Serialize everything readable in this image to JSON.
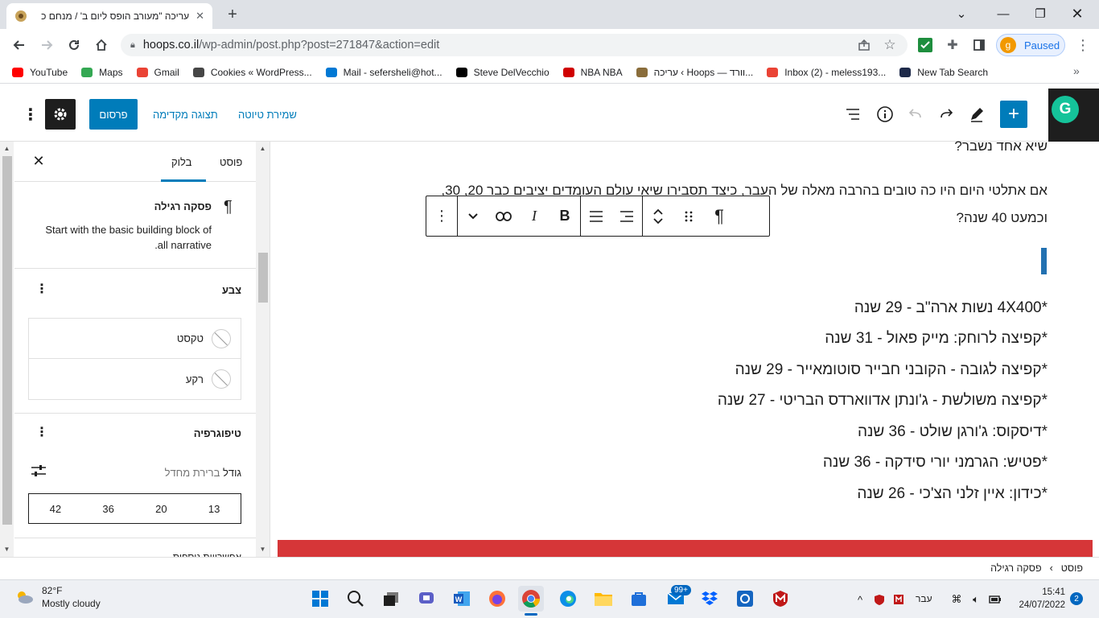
{
  "browser": {
    "tab_title": "עריכה \"מעורב הופס ליום ב' / מנחם כ",
    "url_host": "hoops.co.il",
    "url_path": "/wp-admin/post.php?post=271847&action=edit",
    "profile_initial": "g",
    "profile_status": "Paused"
  },
  "bookmarks": [
    {
      "label": "YouTube",
      "icon": "youtube-icon",
      "color": "#ff0000"
    },
    {
      "label": "Maps",
      "icon": "maps-icon",
      "color": "#34a853"
    },
    {
      "label": "Gmail",
      "icon": "gmail-icon",
      "color": "#ea4335"
    },
    {
      "label": "Cookies « WordPress...",
      "icon": "wordpress-icon",
      "color": "#464646"
    },
    {
      "label": "Mail - sefersheli@hot...",
      "icon": "outlook-icon",
      "color": "#0078d4"
    },
    {
      "label": "Steve DelVecchio",
      "icon": "lbs-icon",
      "color": "#000000"
    },
    {
      "label": "NBA NBA",
      "icon": "espn-icon",
      "color": "#d00000"
    },
    {
      "label": "עריכה ‹ Hoops — וורד...",
      "icon": "hoops-icon",
      "color": "#8a6d3b"
    },
    {
      "label": "Inbox (2) - meless193...",
      "icon": "gmail-icon",
      "color": "#ea4335"
    },
    {
      "label": "New Tab Search",
      "icon": "search-tab-icon",
      "color": "#1e2a4a"
    }
  ],
  "wp_header": {
    "publish": "פרסום",
    "preview": "תצוגה מקדימה",
    "save_draft": "שמירת טיוטה"
  },
  "sidebar": {
    "tab_post": "פוסט",
    "tab_block": "בלוק",
    "block_name": "פסקה רגילה",
    "block_desc_line1": "Start with the basic building block of",
    "block_desc_line2": ".all narrative",
    "color_title": "צבע",
    "color_text": "טקסט",
    "color_background": "רקע",
    "typography_title": "טיפוגרפיה",
    "size_label_prefix": "גודל",
    "size_label_default": "ברירת מחדל",
    "sizes": [
      "13",
      "20",
      "36",
      "42"
    ],
    "next_section": "אפשרויות נוספות"
  },
  "content": {
    "line0": "שיא אחד נשבר?",
    "line1": "אם אתלטי היום היו כה טובים בהרבה מאלה של העבר, כיצד תסבירו שיאי עולם העומדים יציבים כבר 20, 30,",
    "line2": "וכמעט 40 שנה?",
    "bullets": [
      "*4X400 נשות ארה\"ב - 29 שנה",
      "*קפיצה לרוחק: מייק פאול - 31 שנה",
      "*קפיצה לגובה - הקובני חבייר סוטומאייר - 29 שנה",
      "*קפיצה משולשת - ג'ונתן אדווארדס הבריטי - 27 שנה",
      "*דיסקוס: ג'ורגן שולט - 36 שנה",
      "*פטיש: הגרמני יורי סידקה - 36 שנה",
      "*כידון: איין זלני הצ'כי - 26 שנה"
    ]
  },
  "breadcrumb": {
    "root": "פוסט",
    "current": "פסקה רגילה"
  },
  "taskbar": {
    "temp": "82°F",
    "weather": "Mostly cloudy",
    "lang": "עבר",
    "time": "15:41",
    "date": "24/07/2022",
    "notif_count": "2",
    "mail_badge": "99+"
  }
}
